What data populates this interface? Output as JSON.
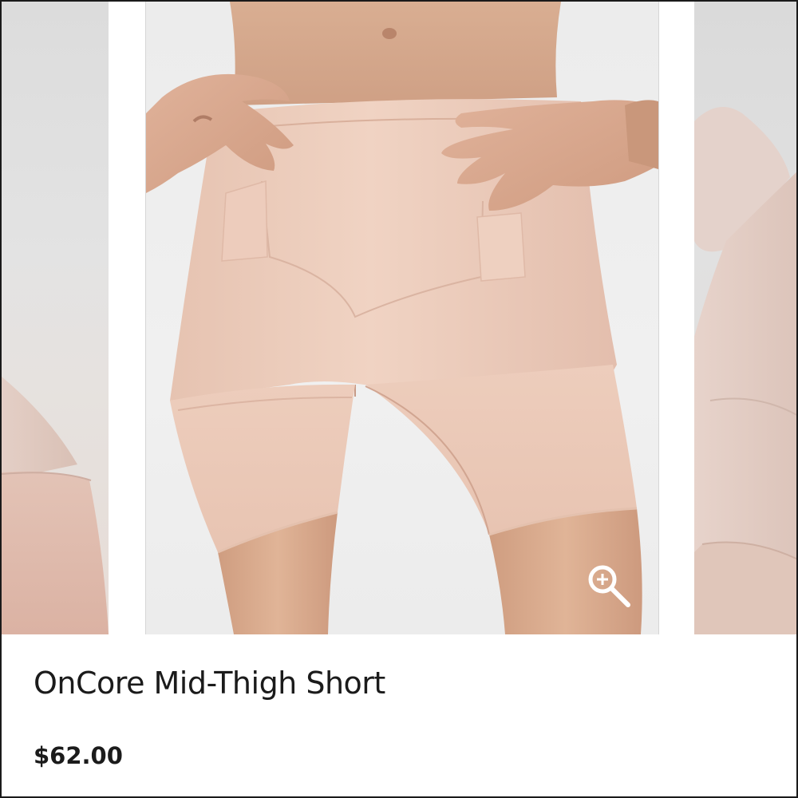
{
  "product": {
    "title": "OnCore Mid-Thigh Short",
    "price": "$62.00"
  },
  "gallery": {
    "images": [
      {
        "position": "previous",
        "subject": "product photo (partial)"
      },
      {
        "position": "current",
        "subject": "product photo"
      },
      {
        "position": "next",
        "subject": "product photo (partial)"
      }
    ],
    "zoom_icon": "zoom-in-icon"
  },
  "colors": {
    "background": "#ffffff",
    "text": "#1b1b1b",
    "fabric_nude": "#e9c9b8",
    "skin": "#d9ad94",
    "photo_backdrop": "#ededed"
  }
}
